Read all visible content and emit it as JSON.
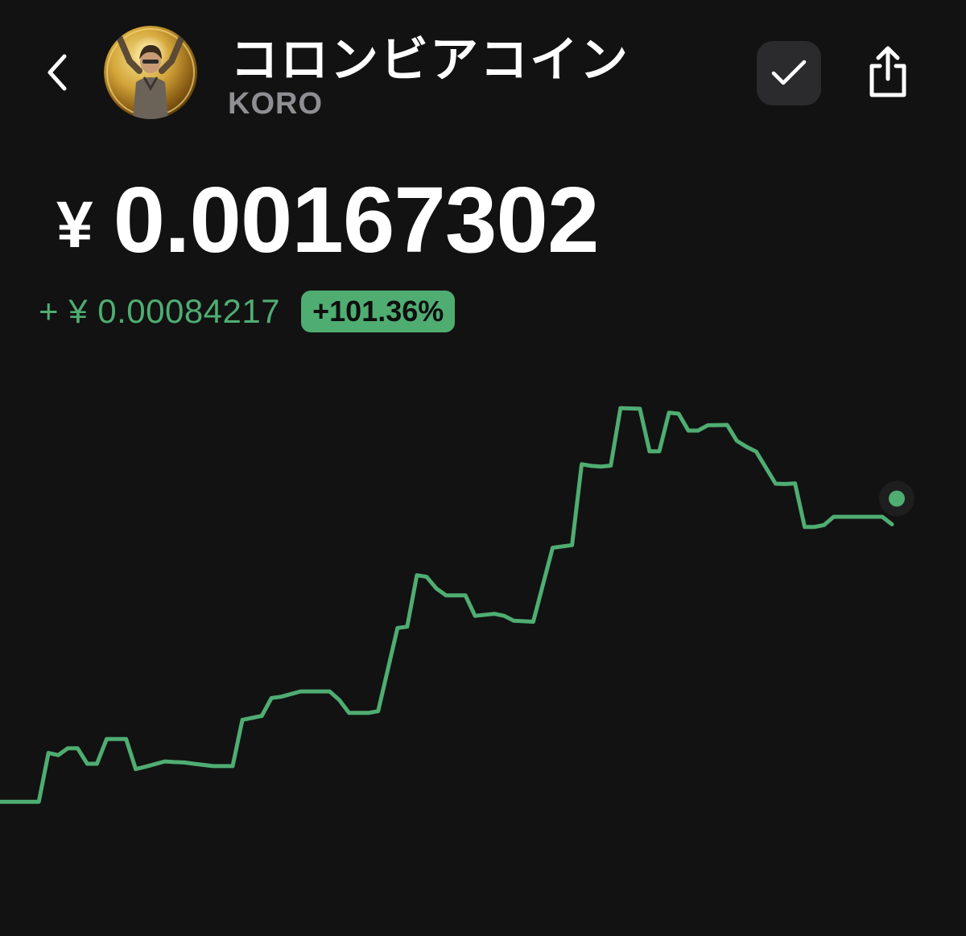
{
  "header": {
    "coin_name": "コロンビアコイン",
    "coin_symbol": "KORO",
    "back_icon": "chevron-left-icon",
    "watch_icon": "checkmark-icon",
    "share_icon": "share-icon"
  },
  "price": {
    "currency": "¥",
    "value": "0.00167302"
  },
  "change": {
    "absolute": "+ ¥ 0.00084217",
    "percent": "+101.36%"
  },
  "colors": {
    "background": "#121212",
    "accent_green": "#4fad72",
    "muted_text": "#8e8e93",
    "button_bg": "#2b2b2d"
  },
  "chart_data": {
    "type": "line",
    "title": "",
    "xlabel": "",
    "ylabel": "",
    "grid": false,
    "ylim": [
      0,
      0.002
    ],
    "x": [
      0,
      4,
      5,
      6,
      7,
      8,
      9,
      10,
      11,
      13,
      14,
      15,
      17,
      18,
      19,
      20,
      22,
      23,
      24,
      25,
      27,
      28,
      29,
      31,
      33,
      34,
      35,
      36,
      37,
      38,
      39,
      41,
      42,
      43,
      44,
      45,
      46,
      47,
      48,
      49,
      51,
      52,
      53,
      55,
      57,
      59,
      60,
      61,
      62,
      63,
      64,
      66,
      67,
      68,
      69,
      70,
      71,
      72,
      73,
      75,
      76,
      77,
      78,
      80,
      81,
      82,
      83,
      84,
      85,
      86,
      87,
      89,
      90,
      91,
      92
    ],
    "values": [
      0.000833,
      0.000833,
      0.000981,
      0.000974,
      0.000995,
      0.000995,
      0.000948,
      0.000948,
      0.001023,
      0.001023,
      0.000932,
      0.000939,
      0.000955,
      0.000953,
      0.000952,
      0.000948,
      0.000941,
      0.000941,
      0.000941,
      0.001081,
      0.001093,
      0.001147,
      0.001151,
      0.001167,
      0.001167,
      0.001167,
      0.001141,
      0.001102,
      0.001102,
      0.001102,
      0.001107,
      0.001359,
      0.001363,
      0.001519,
      0.001514,
      0.001479,
      0.001458,
      0.001458,
      0.001458,
      0.001396,
      0.001402,
      0.001396,
      0.001381,
      0.001378,
      0.001602,
      0.00161,
      0.001855,
      0.00185,
      0.001848,
      0.001851,
      0.002025,
      0.002023,
      0.001894,
      0.001894,
      0.002011,
      0.002008,
      0.001957,
      0.001957,
      0.001973,
      0.001974,
      0.001926,
      0.001908,
      0.001893,
      0.001796,
      0.001795,
      0.001797,
      0.001665,
      0.001665,
      0.001671,
      0.001696,
      0.001696,
      0.001696,
      0.001696,
      0.001696,
      0.001673
    ]
  }
}
